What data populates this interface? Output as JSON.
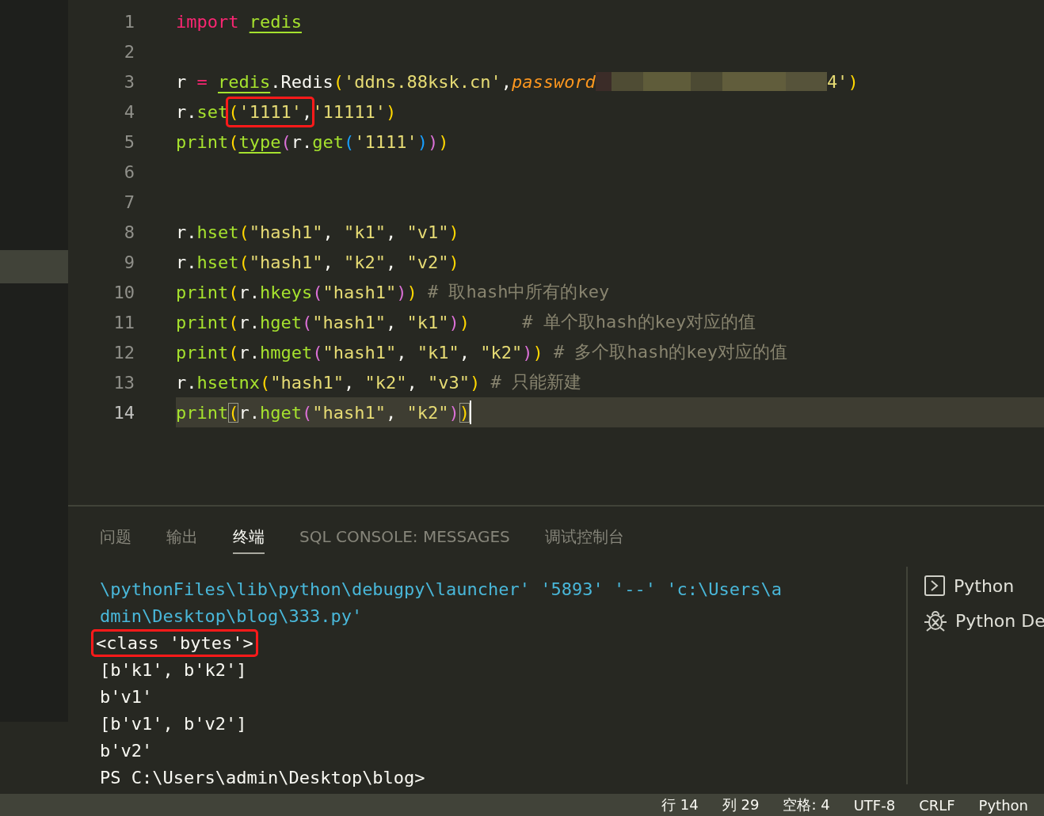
{
  "editor": {
    "lines": [
      {
        "number": "1",
        "current": false,
        "tokens": [
          {
            "kind": "kw",
            "text": "import "
          },
          {
            "kind": "mod",
            "text": "redis"
          }
        ]
      },
      {
        "number": "2",
        "current": false
      },
      {
        "number": "3",
        "current": false,
        "tokens": [
          {
            "kind": "plain",
            "text": "r "
          },
          {
            "kind": "op",
            "text": "= "
          },
          {
            "kind": "mod",
            "text": "redis"
          },
          {
            "kind": "plain",
            "text": ".Redis"
          },
          {
            "kind": "p1",
            "text": "("
          },
          {
            "kind": "str",
            "text": "'ddns.88ksk.cn'"
          },
          {
            "kind": "plain",
            "text": ","
          },
          {
            "kind": "param",
            "text": "password"
          },
          {
            "kind": "redacted"
          },
          {
            "kind": "str",
            "text": "4'"
          },
          {
            "kind": "p1",
            "text": ")"
          }
        ]
      },
      {
        "number": "4",
        "current": false,
        "tokens": [
          {
            "kind": "plain",
            "text": "r."
          },
          {
            "kind": "fn",
            "text": "set"
          },
          {
            "kind": "annotation",
            "tokens": [
              {
                "kind": "p1",
                "text": "("
              },
              {
                "kind": "str",
                "text": "'1111'"
              },
              {
                "kind": "plain",
                "text": ","
              }
            ]
          },
          {
            "kind": "str",
            "text": "'11111'"
          },
          {
            "kind": "p1",
            "text": ")"
          }
        ]
      },
      {
        "number": "5",
        "current": false,
        "tokens": [
          {
            "kind": "fn",
            "text": "print"
          },
          {
            "kind": "p1",
            "text": "("
          },
          {
            "kind": "mod",
            "text": "type"
          },
          {
            "kind": "p2",
            "text": "("
          },
          {
            "kind": "plain",
            "text": "r."
          },
          {
            "kind": "fn",
            "text": "get"
          },
          {
            "kind": "p3",
            "text": "("
          },
          {
            "kind": "str",
            "text": "'1111'"
          },
          {
            "kind": "p3",
            "text": ")"
          },
          {
            "kind": "p2",
            "text": ")"
          },
          {
            "kind": "p1",
            "text": ")"
          }
        ]
      },
      {
        "number": "6",
        "current": false
      },
      {
        "number": "7",
        "current": false
      },
      {
        "number": "8",
        "current": false,
        "tokens": [
          {
            "kind": "plain",
            "text": "r."
          },
          {
            "kind": "fn",
            "text": "hset"
          },
          {
            "kind": "p1",
            "text": "("
          },
          {
            "kind": "str",
            "text": "\"hash1\""
          },
          {
            "kind": "plain",
            "text": ", "
          },
          {
            "kind": "str",
            "text": "\"k1\""
          },
          {
            "kind": "plain",
            "text": ", "
          },
          {
            "kind": "str",
            "text": "\"v1\""
          },
          {
            "kind": "p1",
            "text": ")"
          }
        ]
      },
      {
        "number": "9",
        "current": false,
        "tokens": [
          {
            "kind": "plain",
            "text": "r."
          },
          {
            "kind": "fn",
            "text": "hset"
          },
          {
            "kind": "p1",
            "text": "("
          },
          {
            "kind": "str",
            "text": "\"hash1\""
          },
          {
            "kind": "plain",
            "text": ", "
          },
          {
            "kind": "str",
            "text": "\"k2\""
          },
          {
            "kind": "plain",
            "text": ", "
          },
          {
            "kind": "str",
            "text": "\"v2\""
          },
          {
            "kind": "p1",
            "text": ")"
          }
        ]
      },
      {
        "number": "10",
        "current": false,
        "tokens": [
          {
            "kind": "fn",
            "text": "print"
          },
          {
            "kind": "p1",
            "text": "("
          },
          {
            "kind": "plain",
            "text": "r."
          },
          {
            "kind": "fn",
            "text": "hkeys"
          },
          {
            "kind": "p2",
            "text": "("
          },
          {
            "kind": "str",
            "text": "\"hash1\""
          },
          {
            "kind": "p2",
            "text": ")"
          },
          {
            "kind": "p1",
            "text": ")"
          },
          {
            "kind": "comment",
            "text": " # 取hash中所有的key"
          }
        ]
      },
      {
        "number": "11",
        "current": false,
        "tokens": [
          {
            "kind": "fn",
            "text": "print"
          },
          {
            "kind": "p1",
            "text": "("
          },
          {
            "kind": "plain",
            "text": "r."
          },
          {
            "kind": "fn",
            "text": "hget"
          },
          {
            "kind": "p2",
            "text": "("
          },
          {
            "kind": "str",
            "text": "\"hash1\""
          },
          {
            "kind": "plain",
            "text": ", "
          },
          {
            "kind": "str",
            "text": "\"k1\""
          },
          {
            "kind": "p2",
            "text": ")"
          },
          {
            "kind": "p1",
            "text": ")"
          },
          {
            "kind": "comment",
            "text": "     # 单个取hash的key对应的值"
          }
        ]
      },
      {
        "number": "12",
        "current": false,
        "tokens": [
          {
            "kind": "fn",
            "text": "print"
          },
          {
            "kind": "p1",
            "text": "("
          },
          {
            "kind": "plain",
            "text": "r."
          },
          {
            "kind": "fn",
            "text": "hmget"
          },
          {
            "kind": "p2",
            "text": "("
          },
          {
            "kind": "str",
            "text": "\"hash1\""
          },
          {
            "kind": "plain",
            "text": ", "
          },
          {
            "kind": "str",
            "text": "\"k1\""
          },
          {
            "kind": "plain",
            "text": ", "
          },
          {
            "kind": "str",
            "text": "\"k2\""
          },
          {
            "kind": "p2",
            "text": ")"
          },
          {
            "kind": "p1",
            "text": ")"
          },
          {
            "kind": "comment",
            "text": " # 多个取hash的key对应的值"
          }
        ]
      },
      {
        "number": "13",
        "current": false,
        "tokens": [
          {
            "kind": "plain",
            "text": "r."
          },
          {
            "kind": "fn",
            "text": "hsetnx"
          },
          {
            "kind": "p1",
            "text": "("
          },
          {
            "kind": "str",
            "text": "\"hash1\""
          },
          {
            "kind": "plain",
            "text": ", "
          },
          {
            "kind": "str",
            "text": "\"k2\""
          },
          {
            "kind": "plain",
            "text": ", "
          },
          {
            "kind": "str",
            "text": "\"v3\""
          },
          {
            "kind": "p1",
            "text": ")"
          },
          {
            "kind": "comment",
            "text": " # 只能新建"
          }
        ]
      },
      {
        "number": "14",
        "current": true,
        "tokens": [
          {
            "kind": "fn",
            "text": "print"
          },
          {
            "kind": "match",
            "text": "("
          },
          {
            "kind": "plain",
            "text": "r."
          },
          {
            "kind": "fn",
            "text": "hget"
          },
          {
            "kind": "p2",
            "text": "("
          },
          {
            "kind": "str",
            "text": "\"hash1\""
          },
          {
            "kind": "plain",
            "text": ", "
          },
          {
            "kind": "str",
            "text": "\"k2\""
          },
          {
            "kind": "p2",
            "text": ")"
          },
          {
            "kind": "match",
            "text": ")"
          }
        ]
      }
    ]
  },
  "panel": {
    "tabs": [
      {
        "label": "问题",
        "selected": false
      },
      {
        "label": "输出",
        "selected": false
      },
      {
        "label": "终端",
        "selected": true
      },
      {
        "label": "SQL CONSOLE: MESSAGES",
        "selected": false
      },
      {
        "label": "调试控制台",
        "selected": false
      }
    ],
    "terminal_lines": [
      {
        "kind": "path",
        "text": "\\pythonFiles\\lib\\python\\debugpy\\launcher' '5893' '--' 'c:\\Users\\a"
      },
      {
        "kind": "path",
        "text": "dmin\\Desktop\\blog\\333.py'"
      },
      {
        "kind": "annotated",
        "text": "<class 'bytes'>"
      },
      {
        "kind": "output",
        "text": "[b'k1', b'k2']"
      },
      {
        "kind": "output",
        "text": "b'v1'"
      },
      {
        "kind": "output",
        "text": "[b'v1', b'v2']"
      },
      {
        "kind": "output",
        "text": "b'v2'"
      },
      {
        "kind": "output",
        "text": "PS C:\\Users\\admin\\Desktop\\blog>"
      }
    ],
    "terminals": [
      {
        "kind": "shell",
        "label": "Python"
      },
      {
        "kind": "debug",
        "label": "Python De"
      }
    ]
  },
  "status_bar": [
    "行 14",
    "列 29",
    "空格: 4",
    "UTF-8",
    "CRLF",
    "Python"
  ]
}
